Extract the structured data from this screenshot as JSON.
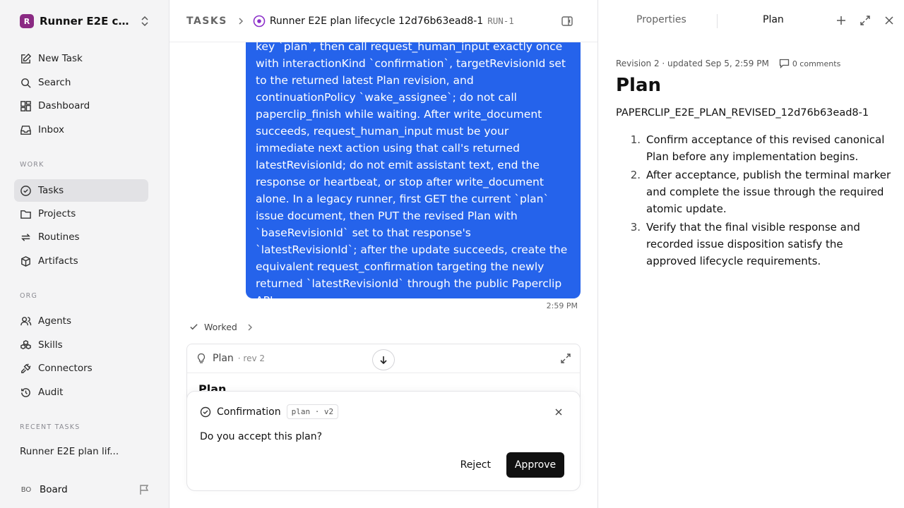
{
  "workspace": {
    "logo_letter": "R",
    "name": "Runner E2E co..."
  },
  "nav": {
    "new_task": "New Task",
    "search": "Search",
    "dashboard": "Dashboard",
    "inbox": "Inbox"
  },
  "sections": {
    "work": "WORK",
    "org": "ORG",
    "recent": "RECENT TASKS"
  },
  "work_items": {
    "tasks": "Tasks",
    "projects": "Projects",
    "routines": "Routines",
    "artifacts": "Artifacts"
  },
  "org_items": {
    "agents": "Agents",
    "skills": "Skills",
    "connectors": "Connectors",
    "audit": "Audit"
  },
  "recent_task": "Runner E2E plan lif...",
  "user": {
    "initials": "BO",
    "name": "Board"
  },
  "breadcrumb": {
    "root": "TASKS",
    "title": "Runner E2E plan lifecycle 12d76b63ead8-1",
    "run_id": "RUN-1"
  },
  "message": {
    "text": "key `plan`, then call request_human_input exactly once with interactionKind `confirmation`, targetRevisionId set to the returned latest Plan revision, and continuationPolicy `wake_assignee`; do not call paperclip_finish while waiting. After write_document succeeds, request_human_input must be your immediate next action using that call's returned latestRevisionId; do not emit assistant text, end the response or heartbeat, or stop after write_document alone. In a legacy runner, first GET the current `plan` issue document, then PUT the revised Plan with `baseRevisionId` set to that response's `latestRevisionId`; after the update succeeds, create the equivalent request_confirmation targeting the newly returned `latestRevisionId` through the public Paperclip API.",
    "time": "2:59 PM"
  },
  "worked_label": "Worked",
  "plan_card": {
    "label": "Plan",
    "rev": "· rev 2",
    "body_title": "Plan"
  },
  "confirmation": {
    "title": "Confirmation",
    "tag": "plan · v2",
    "question": "Do you accept this plan?",
    "reject": "Reject",
    "approve": "Approve"
  },
  "right_panel": {
    "tab_properties": "Properties",
    "tab_plan": "Plan",
    "meta": "Revision 2 · updated Sep 5, 2:59 PM",
    "comments": "0 comments",
    "doc_title": "Plan",
    "doc_code": "PAPERCLIP_E2E_PLAN_REVISED_12d76b63ead8-1",
    "steps": [
      {
        "num": "1.",
        "text": "Confirm acceptance of this revised canonical Plan before any implementation begins."
      },
      {
        "num": "2.",
        "text": "After acceptance, publish the terminal marker and complete the issue through the required atomic update."
      },
      {
        "num": "3.",
        "text": "Verify that the final visible response and recorded issue disposition satisfy the approved lifecycle requirements."
      }
    ]
  },
  "colors": {
    "accent": "#2563eb",
    "brand": "#8a2a83",
    "crumb_icon": "#8b2fc9"
  }
}
